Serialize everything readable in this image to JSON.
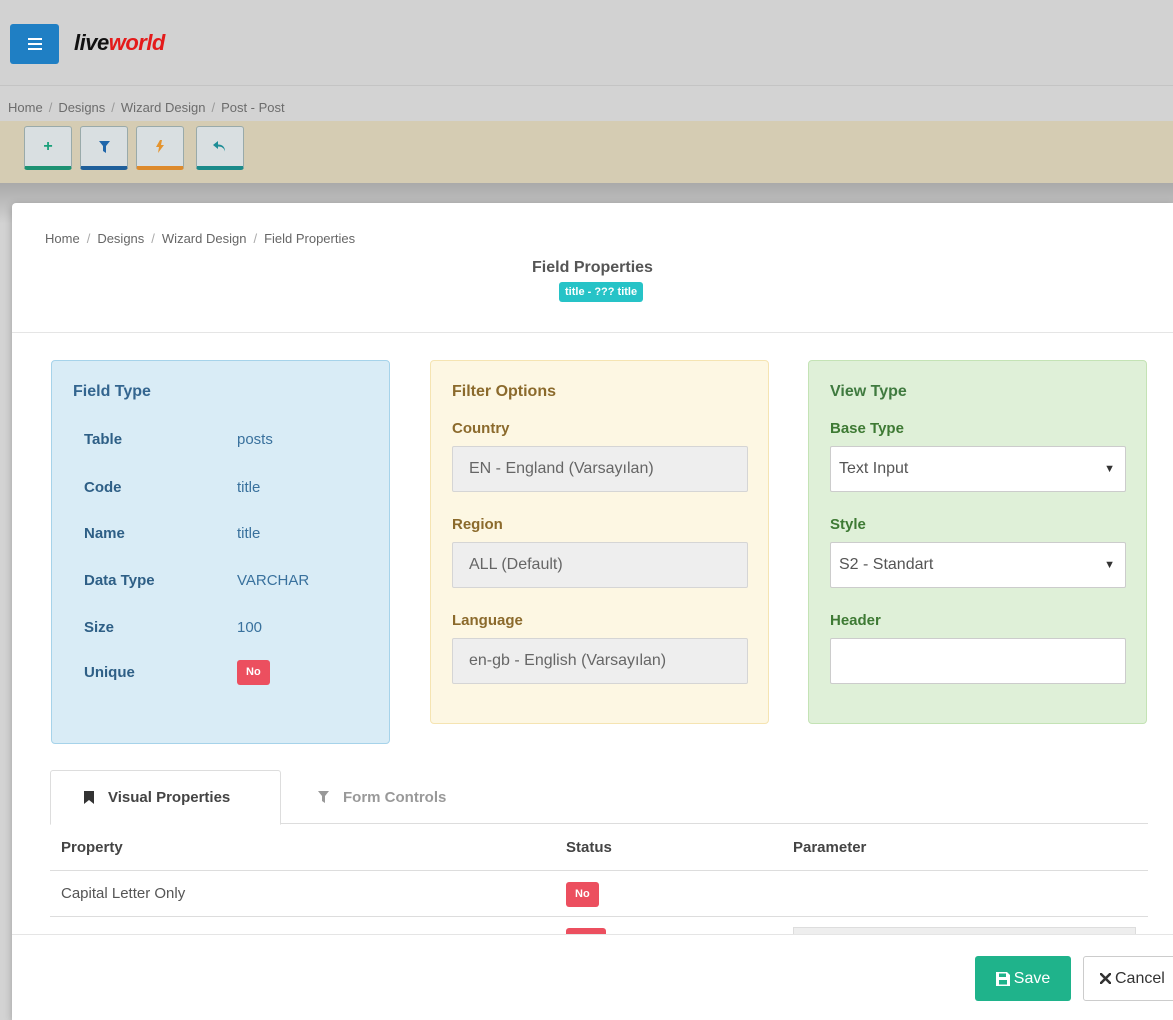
{
  "app": {
    "logo_part1": "live",
    "logo_part2": "world"
  },
  "bg_breadcrumb": [
    "Home",
    "Designs",
    "Wizard Design",
    "Post - Post"
  ],
  "bg_toolbar": [
    {
      "icon": "plus-icon",
      "glyph": "+"
    },
    {
      "icon": "filter-icon",
      "glyph": "▼"
    },
    {
      "icon": "lightning-icon",
      "glyph": "ϟ"
    },
    {
      "icon": "back-arrow-icon",
      "glyph": "↰"
    }
  ],
  "modal": {
    "breadcrumb": [
      "Home",
      "Designs",
      "Wizard Design",
      "Field Properties"
    ],
    "title": "Field Properties",
    "badge": "title - ??? title",
    "field_type": {
      "title": "Field Type",
      "rows": [
        {
          "label": "Table",
          "value": "posts"
        },
        {
          "label": "Code",
          "value": "title"
        },
        {
          "label": "Name",
          "value": "title"
        },
        {
          "label": "Data Type",
          "value": "VARCHAR"
        },
        {
          "label": "Size",
          "value": "100"
        },
        {
          "label": "Unique",
          "badge": "No"
        }
      ]
    },
    "filter_options": {
      "title": "Filter Options",
      "country_label": "Country",
      "country_value": "EN - England (Varsayılan)",
      "region_label": "Region",
      "region_value": "ALL (Default)",
      "language_label": "Language",
      "language_value": "en-gb - English (Varsayılan)"
    },
    "view_type": {
      "title": "View Type",
      "base_type_label": "Base Type",
      "base_type_value": "Text Input",
      "style_label": "Style",
      "style_value": "S2 - Standart",
      "header_label": "Header",
      "header_value": ""
    },
    "tabs": [
      {
        "label": "Visual Properties",
        "icon": "bookmark-icon",
        "active": true
      },
      {
        "label": "Form Controls",
        "icon": "filter-icon",
        "active": false
      }
    ],
    "table": {
      "headers": [
        "Property",
        "Status",
        "Parameter"
      ],
      "rows": [
        {
          "property": "Capital Letter Only",
          "status": "No",
          "parameter": ""
        }
      ]
    },
    "footer": {
      "save_label": "Save",
      "cancel_label": "Cancel"
    }
  },
  "colors": {
    "primary": "#1f7fc4",
    "success": "#1fb38b",
    "danger": "#ec4f5f",
    "info_badge": "#26c3c7"
  }
}
